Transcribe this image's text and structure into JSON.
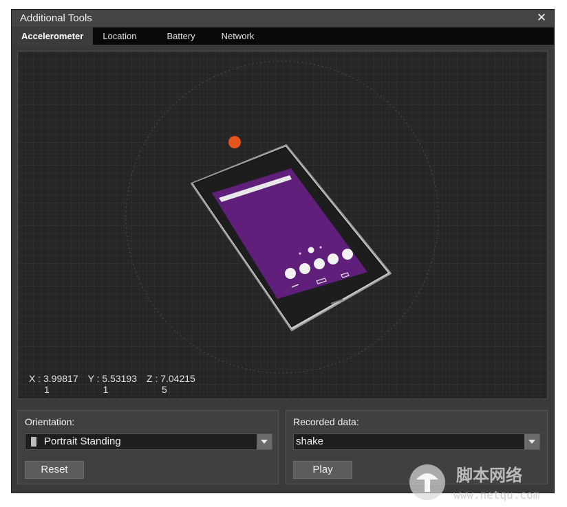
{
  "window": {
    "title": "Additional Tools",
    "close_glyph": "✕",
    "close_icon": "close-icon"
  },
  "tabs": [
    {
      "label": "Accelerometer",
      "active": true
    },
    {
      "label": "Location",
      "active": false
    },
    {
      "label": "Battery",
      "active": false
    },
    {
      "label": "Network",
      "active": false
    }
  ],
  "readouts": {
    "x": {
      "line1": "X : 3.99817",
      "line2": "1"
    },
    "y": {
      "line1": "Y : 5.53193",
      "line2": "1"
    },
    "z": {
      "line1": "Z : 7.04215",
      "line2": "5"
    }
  },
  "orientation": {
    "label": "Orientation:",
    "selected": "Portrait Standing",
    "icon": "portrait-device-icon",
    "reset_label": "Reset"
  },
  "recorded": {
    "label": "Recorded data:",
    "selected": "shake",
    "play_label": "Play"
  },
  "watermark": {
    "text_cn": "脚本网络",
    "text_url": "www.netqu.com"
  },
  "colors": {
    "accent_dot": "#e8531e",
    "screen": "#5e1f78",
    "device_body": "#1c1c1c",
    "device_frame": "#c9c9c9"
  }
}
